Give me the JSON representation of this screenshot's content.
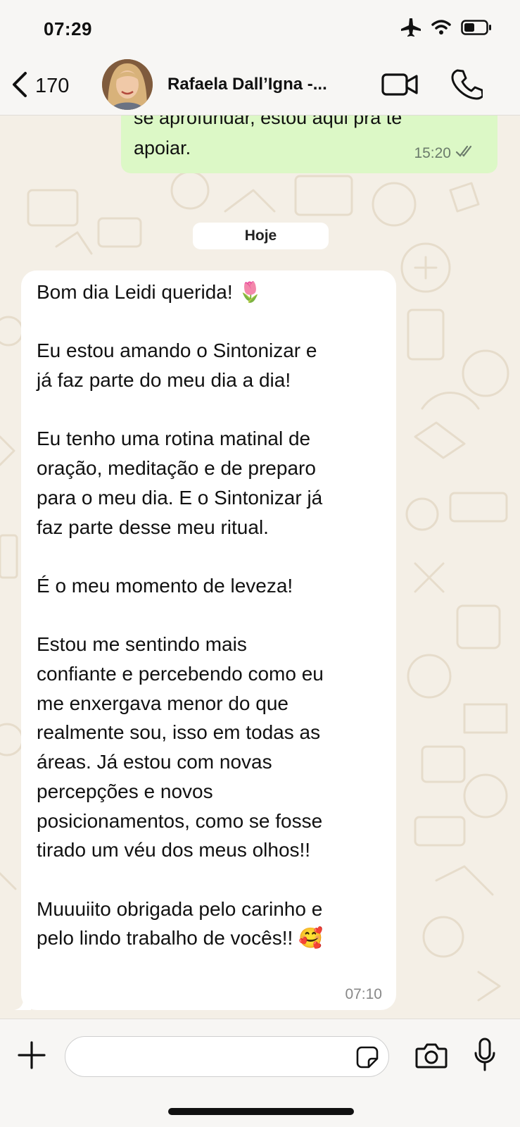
{
  "status_bar": {
    "time": "07:29",
    "icons": [
      "airplane-icon",
      "wifi-icon",
      "battery-icon"
    ]
  },
  "header": {
    "back_count": "170",
    "contact_name": "Rafaela Dall’Igna -...",
    "icons": [
      "chevron-left-icon",
      "video-camera-icon",
      "phone-icon"
    ]
  },
  "messages": {
    "outgoing": {
      "lines": [
        "se aprofundar, estou aqui pra te",
        "apoiar."
      ],
      "time": "15:20",
      "status": "read"
    },
    "date_separator": "Hoje",
    "incoming": {
      "lines": [
        "Bom dia Leidi querida! 🌷",
        "",
        "Eu estou amando o Sintonizar e",
        "já faz parte do meu dia a dia!",
        "",
        "Eu tenho uma rotina matinal de",
        "oração, meditação e de preparo",
        "para o meu dia. E o Sintonizar já",
        "faz parte desse meu ritual.",
        "",
        "É o meu momento de leveza!",
        "",
        "Estou me sentindo mais",
        "confiante e percebendo como eu",
        "me enxergava menor do que",
        "realmente sou, isso em todas as",
        "áreas. Já estou com novas",
        "percepções e novos",
        "posicionamentos, como se fosse",
        "tirado um véu dos meus olhos!!",
        "",
        "Muuuiito obrigada pelo carinho e",
        "pelo lindo trabalho de vocês!! 🥰"
      ],
      "time": "07:10"
    }
  },
  "composer": {
    "placeholder": "",
    "icons": [
      "plus-icon",
      "sticker-icon",
      "camera-icon",
      "microphone-icon"
    ]
  },
  "colors": {
    "wallpaper": "#f4efe6",
    "outgoing_bubble": "#dcf8c6",
    "incoming_bubble": "#ffffff",
    "bars": "#f7f6f4"
  }
}
